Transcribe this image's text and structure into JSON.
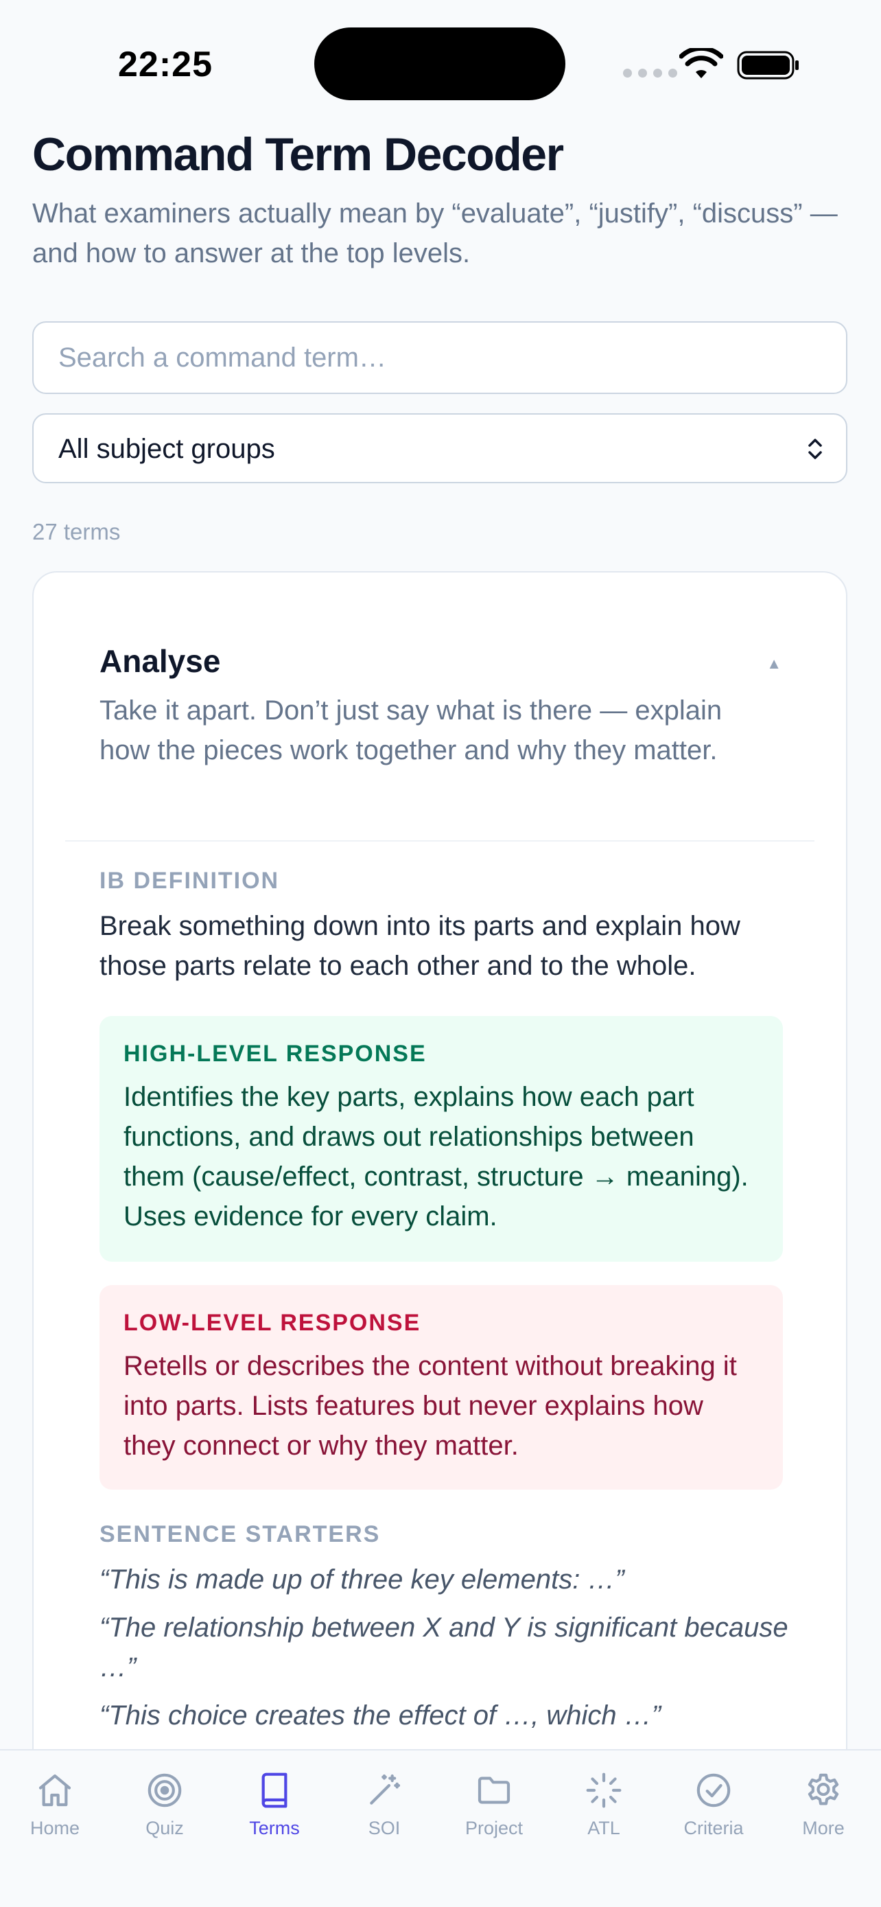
{
  "status_bar": {
    "time": "22:25"
  },
  "header": {
    "title": "Command Term Decoder",
    "subtitle": "What examiners actually mean by “evaluate”, “justify”, “discuss” — and how to answer at the top levels."
  },
  "search": {
    "placeholder": "Search a command term…",
    "value": ""
  },
  "filter": {
    "selected": "All subject groups"
  },
  "term_count": "27 terms",
  "term": {
    "name": "Analyse",
    "summary": "Take it apart. Don’t just say what is there — explain how the pieces work together and why they matter.",
    "definition_label": "IB DEFINITION",
    "definition": "Break something down into its parts and explain how those parts relate to each other and to the whole.",
    "high_label": "HIGH-LEVEL RESPONSE",
    "high_text": "Identifies the key parts, explains how each part functions, and draws out relationships between them (cause/effect, contrast, structure → meaning). Uses evidence for every claim.",
    "low_label": "LOW-LEVEL RESPONSE",
    "low_text": "Retells or describes the content without breaking it into parts. Lists features but never explains how they connect or why they matter.",
    "starters_label": "SENTENCE STARTERS",
    "starters": [
      "“This is made up of three key elements: …”",
      "“The relationship between X and Y is significant because …”",
      "“This choice creates the effect of …, which …”"
    ]
  },
  "tabs": [
    {
      "label": "Home",
      "icon": "home-icon",
      "active": false
    },
    {
      "label": "Quiz",
      "icon": "target-icon",
      "active": false
    },
    {
      "label": "Terms",
      "icon": "book-icon",
      "active": true
    },
    {
      "label": "SOI",
      "icon": "magic-wand-icon",
      "active": false
    },
    {
      "label": "Project",
      "icon": "folder-icon",
      "active": false
    },
    {
      "label": "ATL",
      "icon": "loader-icon",
      "active": false
    },
    {
      "label": "Criteria",
      "icon": "check-circle-icon",
      "active": false
    },
    {
      "label": "More",
      "icon": "gear-icon",
      "active": false
    }
  ],
  "colors": {
    "accent": "#4f46e5",
    "inactive": "#94a3b8",
    "high_bg": "#ecfdf5",
    "low_bg": "#fff1f2"
  }
}
